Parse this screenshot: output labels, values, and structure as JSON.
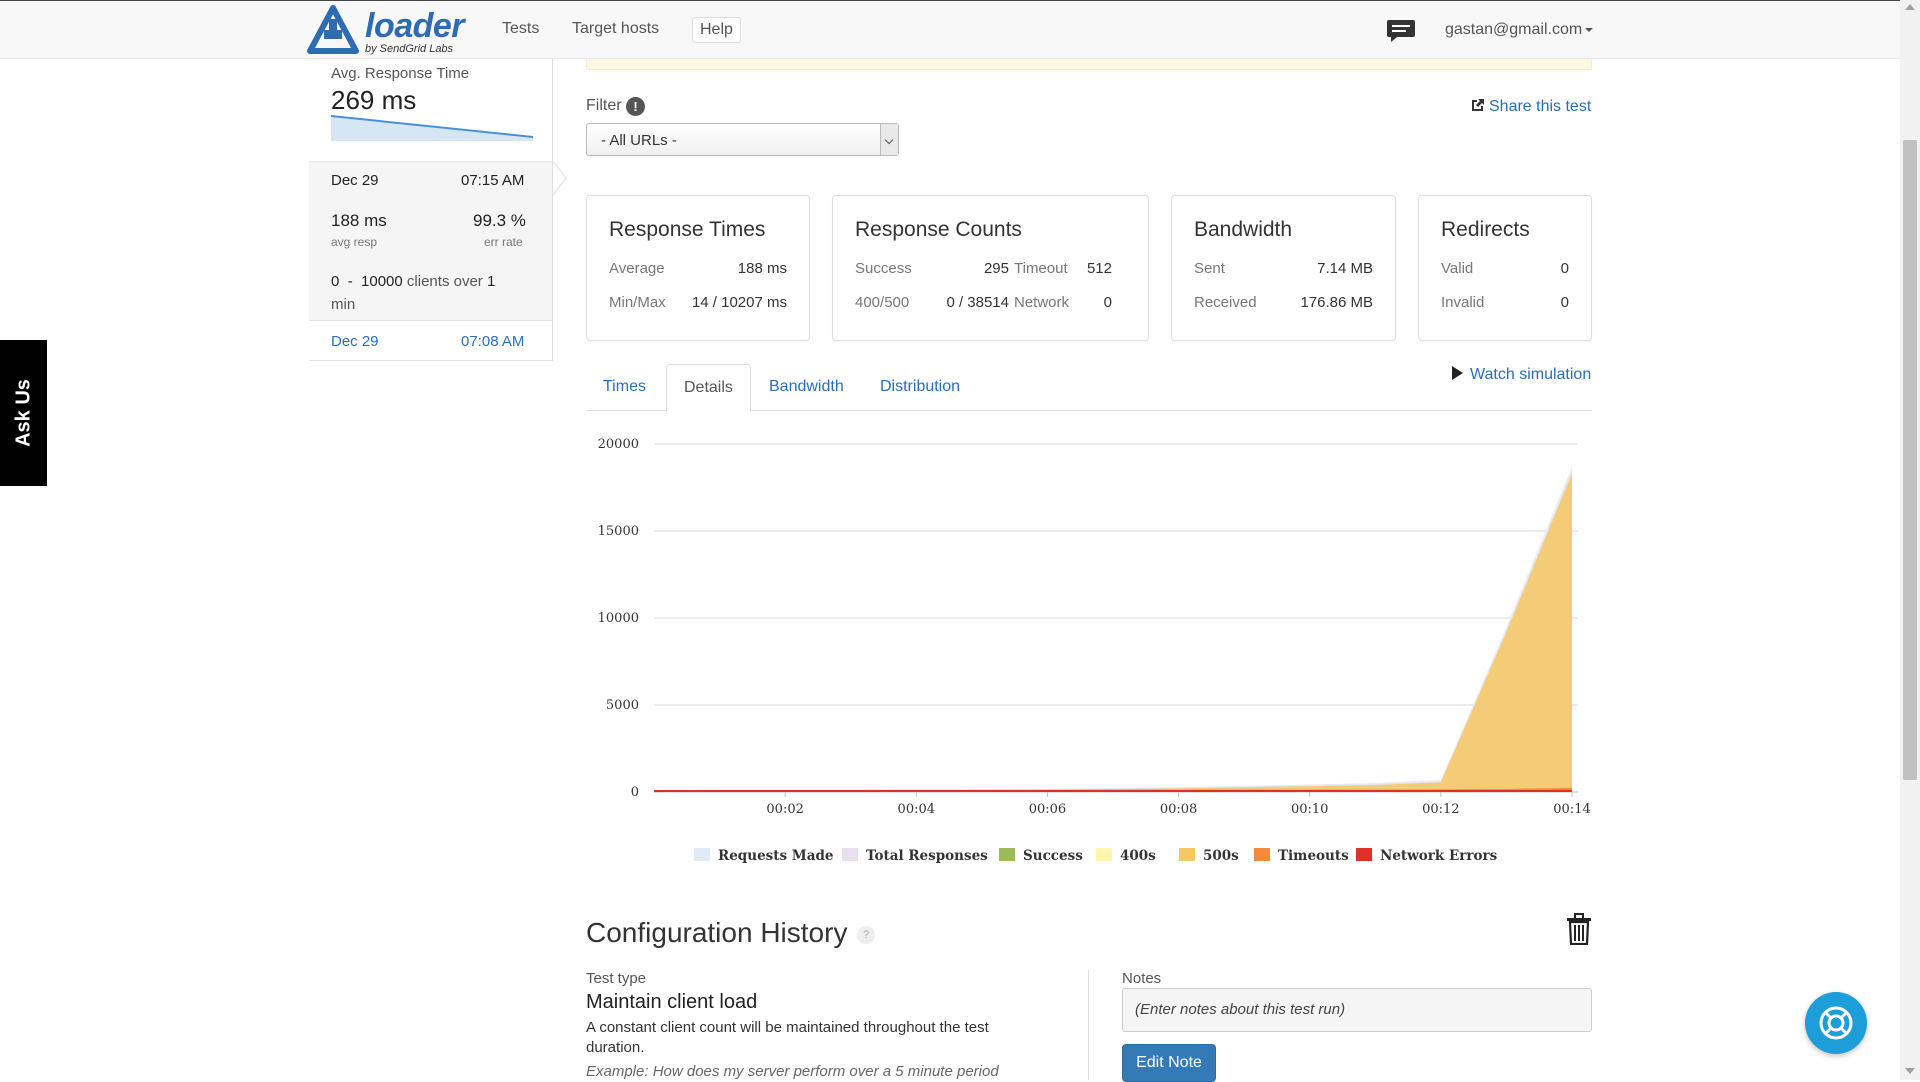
{
  "nav": {
    "logo_word": "loader",
    "logo_sub": "by SendGrid Labs",
    "items": [
      "Tests",
      "Target hosts",
      "Help"
    ],
    "user_email": "gastan@gmail.com"
  },
  "askus": "Ask Us",
  "sidebar": {
    "avg_label": "Avg. Response Time",
    "avg_value": "269 ms",
    "selected_run": {
      "date": "Dec 29",
      "time": "07:15 AM",
      "avg_resp": "188 ms",
      "avg_resp_label": "avg resp",
      "err_rate": "99.3 %",
      "err_rate_label": "err rate",
      "clients_from": "0",
      "clients_dash": "-",
      "clients_to": "10000",
      "clients_text": "clients over",
      "duration_value": "1",
      "duration_unit": "min"
    },
    "other_run": {
      "date": "Dec 29",
      "time": "07:08 AM"
    }
  },
  "filter": {
    "label": "Filter",
    "info": "!",
    "selected": "- All URLs -",
    "share": "Share this test"
  },
  "cards": {
    "response_times": {
      "title": "Response Times",
      "average_label": "Average",
      "average": "188 ms",
      "minmax_label": "Min/Max",
      "minmax": "14 / 10207 ms"
    },
    "response_counts": {
      "title": "Response Counts",
      "success_label": "Success",
      "success": "295",
      "timeout_label": "Timeout",
      "timeout": "512",
      "err_label": "400/500",
      "err": "0 / 38514",
      "network_label": "Network",
      "network": "0"
    },
    "bandwidth": {
      "title": "Bandwidth",
      "sent_label": "Sent",
      "sent": "7.14 MB",
      "received_label": "Received",
      "received": "176.86 MB"
    },
    "redirects": {
      "title": "Redirects",
      "valid_label": "Valid",
      "valid": "0",
      "invalid_label": "Invalid",
      "invalid": "0"
    }
  },
  "tabs": [
    "Times",
    "Details",
    "Bandwidth",
    "Distribution"
  ],
  "active_tab": "Details",
  "watch": "Watch simulation",
  "chart_data": {
    "type": "area",
    "x": [
      "00:00",
      "00:01",
      "00:02",
      "00:03",
      "00:04",
      "00:05",
      "00:06",
      "00:07",
      "00:08",
      "00:09",
      "00:10",
      "00:11",
      "00:12",
      "00:13",
      "00:14"
    ],
    "x_ticks": [
      "00:02",
      "00:04",
      "00:06",
      "00:08",
      "00:10",
      "00:12",
      "00:14"
    ],
    "y_ticks": [
      "0",
      "5000",
      "10000",
      "15000",
      "20000"
    ],
    "ylim": [
      0,
      20000
    ],
    "grid": true,
    "legend_position": "bottom",
    "series": [
      {
        "name": "Requests Made",
        "color": "#e1ebf5",
        "values": [
          0,
          20,
          50,
          80,
          100,
          130,
          170,
          220,
          290,
          360,
          430,
          520,
          700,
          9500,
          18700
        ]
      },
      {
        "name": "Total Responses",
        "color": "#e8dff0",
        "values": [
          0,
          15,
          40,
          70,
          90,
          120,
          150,
          190,
          250,
          310,
          370,
          450,
          600,
          9300,
          18500
        ]
      },
      {
        "name": "Success",
        "color": "#9bbb59",
        "values": [
          0,
          5,
          10,
          15,
          18,
          20,
          22,
          24,
          25,
          26,
          27,
          28,
          28,
          29,
          29
        ]
      },
      {
        "name": "400s",
        "color": "#fff6b0",
        "values": [
          0,
          0,
          0,
          0,
          0,
          0,
          0,
          0,
          0,
          0,
          0,
          0,
          0,
          0,
          0
        ]
      },
      {
        "name": "500s",
        "color": "#f6c862",
        "values": [
          0,
          10,
          30,
          55,
          70,
          95,
          120,
          160,
          210,
          270,
          330,
          400,
          550,
          9200,
          18300
        ]
      },
      {
        "name": "Timeouts",
        "color": "#f28c3a",
        "values": [
          0,
          5,
          8,
          10,
          12,
          14,
          16,
          18,
          20,
          22,
          25,
          30,
          35,
          60,
          120
        ]
      },
      {
        "name": "Network Errors",
        "color": "#e0302a",
        "values": [
          0,
          0,
          0,
          0,
          0,
          0,
          0,
          0,
          0,
          0,
          0,
          0,
          0,
          0,
          0
        ]
      }
    ]
  },
  "config": {
    "title": "Configuration History",
    "help": "?",
    "test_type_label": "Test type",
    "test_type": "Maintain client load",
    "description": "A constant client count will be maintained throughout the test duration.",
    "example": "Example: How does my server perform over a 5 minute period",
    "notes_label": "Notes",
    "notes_placeholder": "(Enter notes about this test run)",
    "edit_note": "Edit Note"
  },
  "colors": {
    "link": "#2a6ebb",
    "brand": "#2f6bb3",
    "primary_button": "#337ab7",
    "fab": "#1e9ed8"
  }
}
